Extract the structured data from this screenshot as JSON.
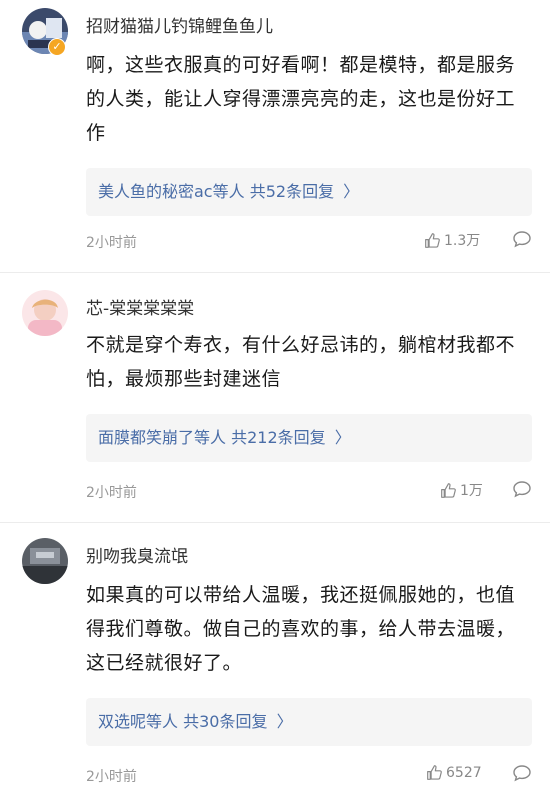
{
  "comments": [
    {
      "username": "招财猫猫儿钓锦鲤鱼鱼儿",
      "content": "啊，这些衣服真的可好看啊！都是模特，都是服务的人类，能让人穿得漂漂亮亮的走，这也是份好工作",
      "reply_who": "美人鱼的秘密ac等人",
      "reply_count": "共52条回复",
      "chevron": "〉",
      "time": "2小时前",
      "likes": "1.3万",
      "avatar_icon": "avatar-cartoon-icon",
      "badge_icon": "verified-badge-icon"
    },
    {
      "username": "芯-棠棠棠棠棠",
      "content": "不就是穿个寿衣，有什么好忌讳的，躺棺材我都不怕，最烦那些封建迷信",
      "reply_who": "面膜都笑崩了等人",
      "reply_count": "共212条回复",
      "chevron": "〉",
      "time": "2小时前",
      "likes": "1万",
      "avatar_icon": "avatar-pink-icon"
    },
    {
      "username": "别吻我臭流氓",
      "content": "如果真的可以带给人温暖，我还挺佩服她的，也值得我们尊敬。做自己的喜欢的事，给人带去温暖，这已经就很好了。",
      "reply_who": "双选呢等人",
      "reply_count": "共30条回复",
      "chevron": "〉",
      "time": "2小时前",
      "likes": "6527",
      "avatar_icon": "avatar-dark-icon"
    }
  ],
  "colors": {
    "link": "#4a6da7",
    "meta": "#999999",
    "reply_bg": "#f5f5f5"
  }
}
